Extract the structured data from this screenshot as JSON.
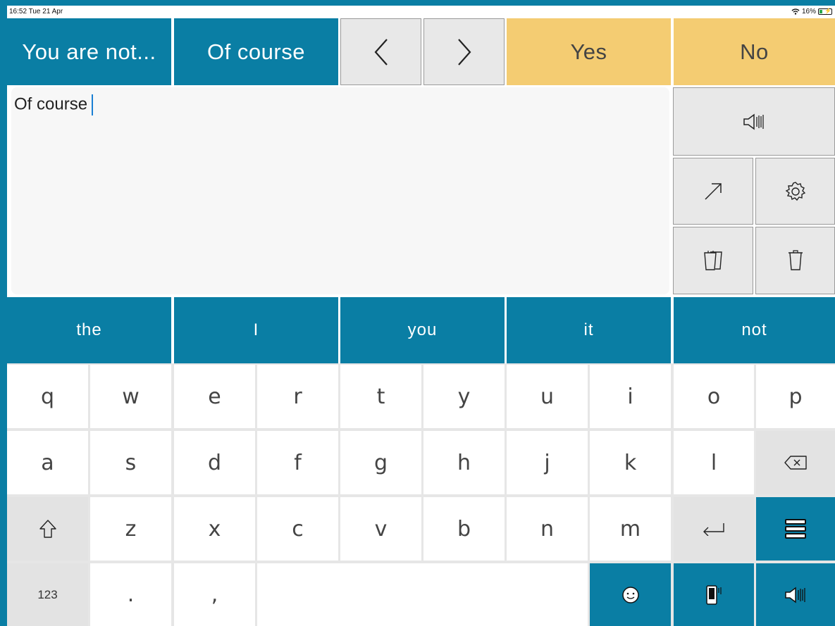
{
  "status": {
    "time": "16:52  Tue 21 Apr",
    "battery": "16%"
  },
  "phrases": [
    {
      "label": "You are not..."
    },
    {
      "label": "Of course"
    }
  ],
  "answers": {
    "yes": "Yes",
    "no": "No"
  },
  "text_input": {
    "value": "Of course"
  },
  "predictions": [
    "the",
    "I",
    "you",
    "it",
    "not"
  ],
  "keys": {
    "row1": [
      "q",
      "w",
      "e",
      "r",
      "t",
      "y",
      "u",
      "i",
      "o",
      "p"
    ],
    "row2": [
      "a",
      "s",
      "d",
      "f",
      "g",
      "h",
      "j",
      "k",
      "l"
    ],
    "row3": [
      "z",
      "x",
      "c",
      "v",
      "b",
      "n",
      "m"
    ],
    "numbers": "123",
    "period": ".",
    "comma": ","
  },
  "colors": {
    "accent": "#0a7ea4",
    "yellow": "#f4cc72",
    "key_grey": "#e3e3e3"
  }
}
